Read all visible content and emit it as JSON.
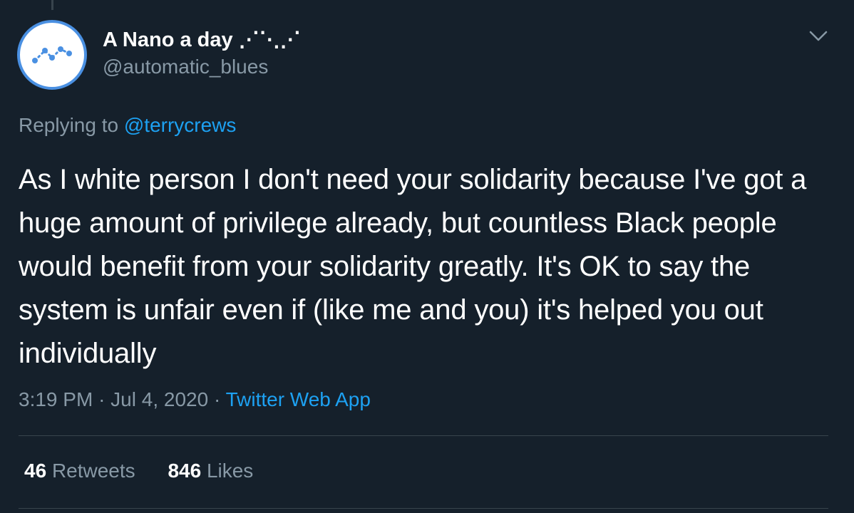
{
  "author": {
    "display_name": "A Nano a day ⋰⋱⋰",
    "handle": "@automatic_blues",
    "avatar_icon": "nano-logo-icon"
  },
  "reply": {
    "prefix": "Replying to",
    "mention": "@terrycrews"
  },
  "tweet": {
    "text": "As I white person I don't need your solidarity because I've got a huge amount of privilege already, but countless Black people would benefit from your solidarity greatly. It's OK to say the system is unfair even if (like me and you) it's helped you out individually"
  },
  "meta": {
    "time": "3:19 PM",
    "separator1": "·",
    "date": "Jul 4, 2020",
    "separator2": "·",
    "source": "Twitter Web App"
  },
  "stats": {
    "retweets_count": "46",
    "retweets_label": "Retweets",
    "likes_count": "846",
    "likes_label": "Likes"
  },
  "colors": {
    "background": "#15202b",
    "accent": "#1da1f2",
    "secondary_text": "#8899a6",
    "avatar_ring": "#4a90e2"
  }
}
